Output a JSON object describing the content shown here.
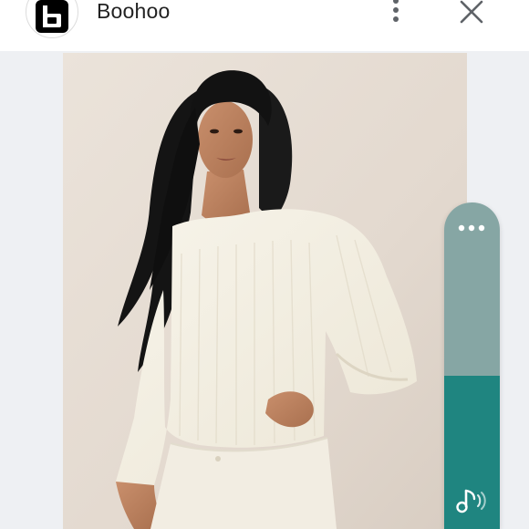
{
  "header": {
    "app_title": "Boohoo",
    "logo_icon": "boohoo-logo-icon",
    "menu_icon": "more-vertical-icon",
    "close_icon": "close-icon"
  },
  "product_image": {
    "description_icon": "product-photo",
    "background_color": "#e6ddd4",
    "sweater_color": "#f4f0e4"
  },
  "side_widget": {
    "top_color": "#86a6a4",
    "bottom_color": "#1f8580",
    "more_icon": "more-horizontal-icon",
    "audio_icon": "music-audio-icon"
  },
  "colors": {
    "page_background": "#eef0f3",
    "header_background": "#ffffff",
    "title_text": "#222222",
    "icon_gray": "#5f6368"
  }
}
